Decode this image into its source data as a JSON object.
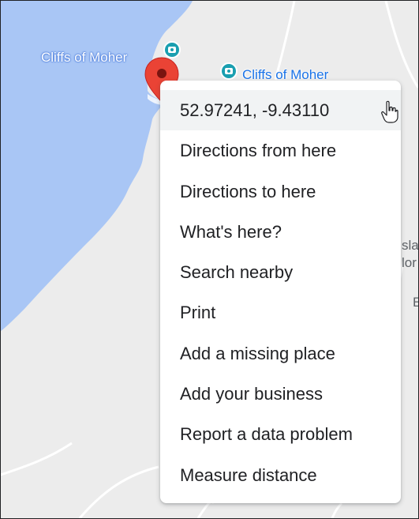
{
  "map": {
    "water_label": "Cliffs of Moher",
    "poi_label": "Cliffs of Moher",
    "partial_labels": [
      "sla",
      "lor",
      "E"
    ]
  },
  "icons": {
    "poi": "camera-viewpoint-icon",
    "pin": "map-pin-icon",
    "cursor": "hand-pointer-icon"
  },
  "colors": {
    "water": "#a9c6f5",
    "land": "#ececec",
    "pin": "#ea4335",
    "poi_text": "#1a73e8",
    "poi_icon": "#1a9fb0"
  },
  "context_menu": {
    "items": [
      {
        "label": "52.97241, -9.43110"
      },
      {
        "label": "Directions from here"
      },
      {
        "label": "Directions to here"
      },
      {
        "label": "What's here?"
      },
      {
        "label": "Search nearby"
      },
      {
        "label": "Print"
      },
      {
        "label": "Add a missing place"
      },
      {
        "label": "Add your business"
      },
      {
        "label": "Report a data problem"
      },
      {
        "label": "Measure distance"
      }
    ]
  }
}
